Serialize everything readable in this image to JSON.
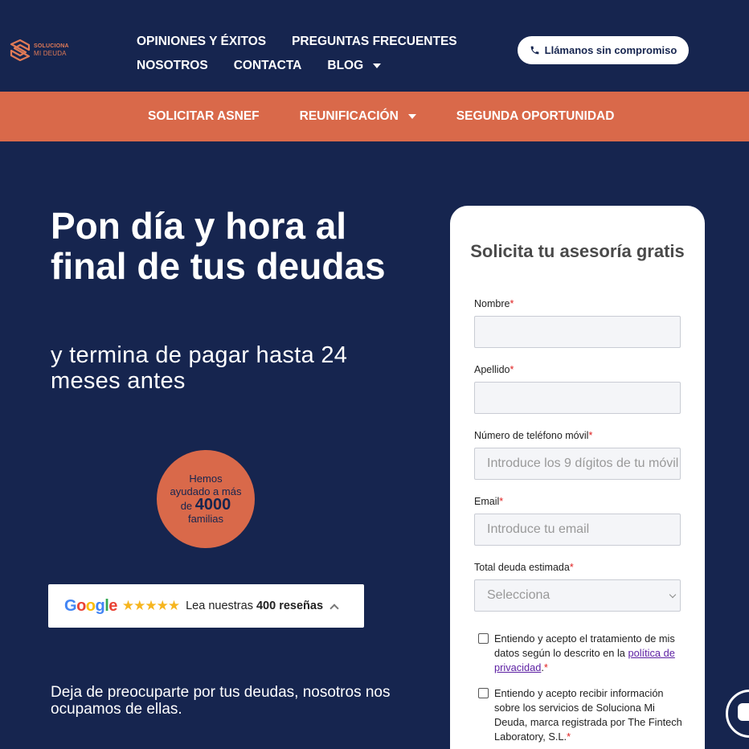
{
  "brand": {
    "line1": "SOLUCIONA",
    "line2": "MI DEUDA",
    "color": "#e07a56"
  },
  "nav": {
    "row1": [
      "OPINIONES Y ÉXITOS",
      "PREGUNTAS FRECUENTES"
    ],
    "row2": [
      "NOSOTROS",
      "CONTACTA",
      "BLOG"
    ]
  },
  "call_button": {
    "label": "Llámanos sin compromiso",
    "icon": "phone-icon"
  },
  "subnav": {
    "items": [
      "SOLICITAR ASNEF",
      "REUNIFICACIÓN",
      "SEGUNDA OPORTUNIDAD"
    ]
  },
  "hero": {
    "title": "Pon día y hora al final de tus deudas",
    "subtitle": "y termina de pagar hasta 24 meses antes",
    "footer_text": "Deja de preocuparte por tus deudas, nosotros nos ocupamos de ellas."
  },
  "badge": {
    "line1": "Hemos",
    "line2": "ayudado a más",
    "prefix": "de",
    "number": "4000",
    "line4": "familias"
  },
  "reviews": {
    "logo_letters": [
      "G",
      "o",
      "o",
      "g",
      "l",
      "e"
    ],
    "stars": "★★★★★",
    "rating_fraction": 0.9,
    "text_prefix": "Lea nuestras",
    "text_bold": "400 reseñas"
  },
  "form": {
    "title": "Solicita tu asesoría gratis",
    "required_mark": "*",
    "fields": {
      "nombre": {
        "label": "Nombre",
        "value": "",
        "placeholder": ""
      },
      "apellido": {
        "label": "Apellido",
        "value": "",
        "placeholder": ""
      },
      "telefono": {
        "label": "Número de teléfono móvil",
        "value": "",
        "placeholder": "Introduce los 9 dígitos de tu móvil"
      },
      "email": {
        "label": "Email",
        "value": "",
        "placeholder": "Introduce tu email"
      },
      "deuda": {
        "label": "Total deuda estimada",
        "selected": "Selecciona"
      }
    },
    "consent1": {
      "text": "Entiendo y acepto el tratamiento de mis datos según lo descrito en la",
      "link": "política de privacidad",
      "suffix": "."
    },
    "consent2": {
      "text": "Entiendo y acepto recibir información sobre los servicios de Soluciona Mi Deuda, marca registrada por The Fintech Laboratory, S.L."
    }
  },
  "colors": {
    "navy": "#16254f",
    "accent": "#d9694a"
  }
}
